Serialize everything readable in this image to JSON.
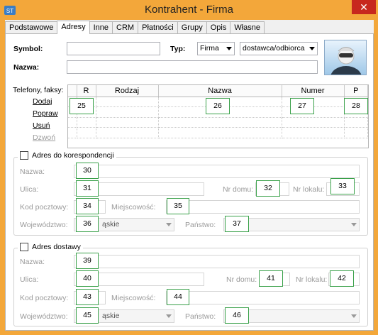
{
  "window": {
    "title": "Kontrahent - Firma",
    "close_glyph": "✕",
    "app_icon": "app-icon"
  },
  "tabs": [
    {
      "label": "Podstawowe"
    },
    {
      "label": "Adresy"
    },
    {
      "label": "Inne"
    },
    {
      "label": "CRM"
    },
    {
      "label": "Płatności"
    },
    {
      "label": "Grupy"
    },
    {
      "label": "Opis"
    },
    {
      "label": "Własne"
    }
  ],
  "active_tab": "Adresy",
  "header": {
    "symbol_label": "Symbol:",
    "symbol_value": "",
    "typ_label": "Typ:",
    "typ_value": "Firma",
    "relation_value": "dostawca/odbiorca",
    "nazwa_label": "Nazwa:",
    "nazwa_value": ""
  },
  "phones": {
    "label": "Telefony, faksy:",
    "columns": [
      "R",
      "Rodzaj",
      "Nazwa",
      "Numer",
      "P"
    ],
    "actions": [
      "Dodaj",
      "Popraw",
      "Usuń",
      "Dzwoń"
    ],
    "markers": [
      "25",
      "26",
      "27",
      "28"
    ]
  },
  "correspondence": {
    "title": "Adres do korespondencji",
    "nazwa_label": "Nazwa:",
    "ulica_label": "Ulica:",
    "nr_domu_label": "Nr domu:",
    "nr_lokalu_label": "Nr lokalu:",
    "kod_label": "Kod pocztowy:",
    "miejscowosc_label": "Miejscowość:",
    "wojewodztwo_label": "Województwo:",
    "wojewodztwo_value": "ąskie",
    "panstwo_label": "Państwo:",
    "markers": {
      "nazwa": "30",
      "ulica": "31",
      "nr_domu": "32",
      "nr_lokalu": "33",
      "kod": "34",
      "miejscowosc": "35",
      "wojewodztwo": "36",
      "panstwo": "37"
    }
  },
  "delivery": {
    "title": "Adres dostawy",
    "nazwa_label": "Nazwa:",
    "ulica_label": "Ulica:",
    "nr_domu_label": "Nr domu:",
    "nr_lokalu_label": "Nr lokalu:",
    "kod_label": "Kod pocztowy:",
    "miejscowosc_label": "Miejscowość:",
    "wojewodztwo_label": "Województwo:",
    "wojewodztwo_value": "ąskie",
    "panstwo_label": "Państwo:",
    "markers": {
      "nazwa": "39",
      "ulica": "40",
      "nr_domu": "41",
      "nr_lokalu": "42",
      "kod": "43",
      "miejscowosc": "44",
      "wojewodztwo": "45",
      "panstwo": "46"
    }
  },
  "colors": {
    "titlebar": "#f3a73a",
    "close": "#c7281e",
    "marker_border": "#3aa14a"
  }
}
